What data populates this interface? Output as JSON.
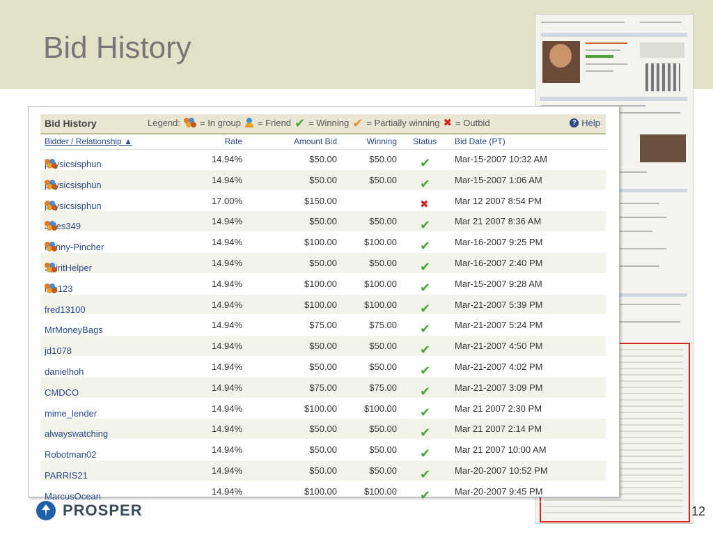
{
  "slide": {
    "title": "Bid History",
    "brand": "PROSPER",
    "page_number": "12"
  },
  "panel": {
    "title": "Bid History",
    "legend_label": "Legend:",
    "legend_items": [
      "= In group",
      "= Friend",
      "= Winning",
      "= Partially winning",
      "= Outbid"
    ],
    "help_label": "Help"
  },
  "columns": [
    "Bidder / Relationship ▲",
    "Rate",
    "Amount Bid",
    "Winning",
    "Status",
    "Bid Date (PT)"
  ],
  "rows": [
    {
      "bidder": "physicsisphun",
      "group": true,
      "rate": "14.94%",
      "amount": "$50.00",
      "winning": "$50.00",
      "status": "winning",
      "date": "Mar-15-2007 10:32 AM"
    },
    {
      "bidder": "physicsisphun",
      "group": true,
      "rate": "14.94%",
      "amount": "$50.00",
      "winning": "$50.00",
      "status": "winning",
      "date": "Mar-15-2007 1:06 AM"
    },
    {
      "bidder": "physicsisphun",
      "group": true,
      "rate": "17.00%",
      "amount": "$150.00",
      "winning": "",
      "status": "outbid",
      "date": "Mar 12 2007 8:54 PM"
    },
    {
      "bidder": "Jules349",
      "group": true,
      "rate": "14.94%",
      "amount": "$50.00",
      "winning": "$50.00",
      "status": "winning",
      "date": "Mar 21 2007 8:36 AM"
    },
    {
      "bidder": "Penny-Pincher",
      "group": true,
      "rate": "14.94%",
      "amount": "$100.00",
      "winning": "$100.00",
      "status": "winning",
      "date": "Mar-16-2007 9:25 PM"
    },
    {
      "bidder": "SpiritHelper",
      "group": true,
      "rate": "14.94%",
      "amount": "$50.00",
      "winning": "$50.00",
      "status": "winning",
      "date": "Mar-16-2007 2:40 PM"
    },
    {
      "bidder": "rbh123",
      "group": true,
      "rate": "14.94%",
      "amount": "$100.00",
      "winning": "$100.00",
      "status": "winning",
      "date": "Mar-15-2007 9:28 AM"
    },
    {
      "bidder": "fred13100",
      "group": false,
      "rate": "14.94%",
      "amount": "$100.00",
      "winning": "$100.00",
      "status": "winning",
      "date": "Mar-21-2007 5:39 PM"
    },
    {
      "bidder": "MrMoneyBags",
      "group": false,
      "rate": "14.94%",
      "amount": "$75.00",
      "winning": "$75.00",
      "status": "winning",
      "date": "Mar-21-2007 5:24 PM"
    },
    {
      "bidder": "jd1078",
      "group": false,
      "rate": "14.94%",
      "amount": "$50.00",
      "winning": "$50.00",
      "status": "winning",
      "date": "Mar-21-2007 4:50 PM"
    },
    {
      "bidder": "danielhoh",
      "group": false,
      "rate": "14.94%",
      "amount": "$50.00",
      "winning": "$50.00",
      "status": "winning",
      "date": "Mar-21-2007 4:02 PM"
    },
    {
      "bidder": "CMDCO",
      "group": false,
      "rate": "14.94%",
      "amount": "$75.00",
      "winning": "$75.00",
      "status": "winning",
      "date": "Mar-21-2007 3:09 PM"
    },
    {
      "bidder": "mime_lender",
      "group": false,
      "rate": "14.94%",
      "amount": "$100.00",
      "winning": "$100.00",
      "status": "winning",
      "date": "Mar 21 2007 2:30 PM"
    },
    {
      "bidder": "alwayswatching",
      "group": false,
      "rate": "14.94%",
      "amount": "$50.00",
      "winning": "$50.00",
      "status": "winning",
      "date": "Mar 21 2007 2:14 PM"
    },
    {
      "bidder": "Robotman02",
      "group": false,
      "rate": "14.94%",
      "amount": "$50.00",
      "winning": "$50.00",
      "status": "winning",
      "date": "Mar 21 2007 10:00 AM"
    },
    {
      "bidder": "PARRIS21",
      "group": false,
      "rate": "14.94%",
      "amount": "$50.00",
      "winning": "$50.00",
      "status": "winning",
      "date": "Mar-20-2007 10:52 PM"
    },
    {
      "bidder": "MarcusOcean",
      "group": false,
      "rate": "14.94%",
      "amount": "$100.00",
      "winning": "$100.00",
      "status": "winning",
      "date": "Mar-20-2007 9:45 PM"
    }
  ],
  "colors": {
    "header_band": "#e3e1c8",
    "link": "#2a4a8a",
    "winning": "#4aa63a",
    "outbid": "#d02020",
    "highlight_box": "#dd2222"
  }
}
